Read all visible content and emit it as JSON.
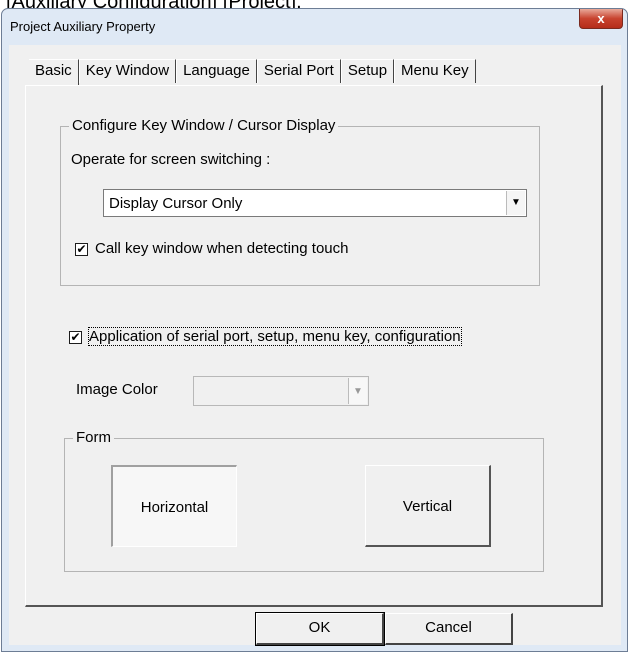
{
  "caption": "[Auxiliary Configuration] [Project].",
  "window": {
    "title": "Project Auxiliary Property",
    "close_symbol": "x"
  },
  "tabs": [
    "Basic",
    "Key Window",
    "Language",
    "Serial Port",
    "Setup",
    "Menu Key"
  ],
  "active_tab": "Basic",
  "key_window_group": {
    "label": "Configure Key Window / Cursor Display",
    "operate_label": "Operate for screen switching :",
    "operate_value": "Display Cursor Only",
    "call_key_checkbox": {
      "label": "Call key window when detecting touch",
      "checked": true
    }
  },
  "serial_checkbox": {
    "label": "Application of serial port, setup, menu key, configuration",
    "checked": true
  },
  "image_color": {
    "label": "Image Color",
    "value": "",
    "enabled": false
  },
  "form_group": {
    "label": "Form",
    "horizontal": "Horizontal",
    "vertical": "Vertical",
    "selected": "Horizontal"
  },
  "buttons": {
    "ok": "OK",
    "cancel": "Cancel"
  },
  "glyphs": {
    "check": "✔",
    "dropdown": "▼"
  }
}
